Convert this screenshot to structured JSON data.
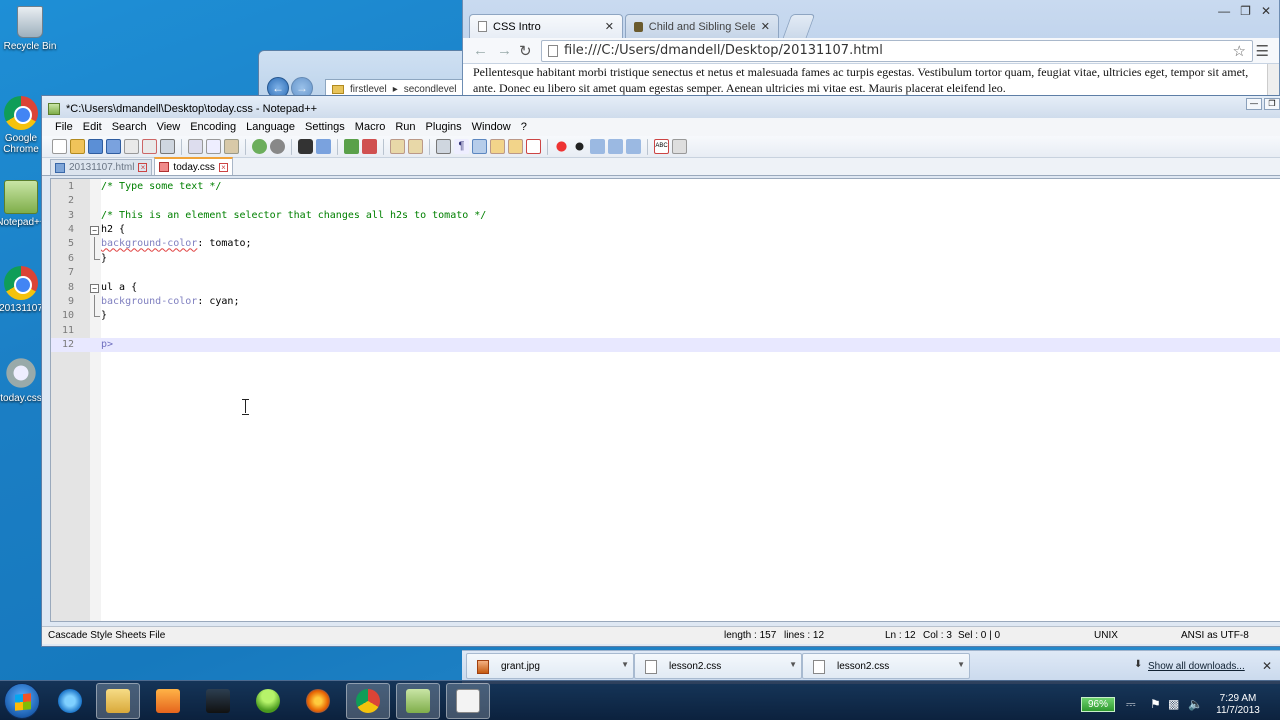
{
  "desktop": {
    "icons": [
      {
        "label": "Recycle Bin",
        "icon": "recycle-bin-icon"
      },
      {
        "label": "Google Chrome",
        "icon": "chrome-icon"
      },
      {
        "label": "Notepad++",
        "icon": "notepad-plus-plus-icon"
      },
      {
        "label": "20131107",
        "icon": "chrome-icon"
      },
      {
        "label": "today.css",
        "icon": "gear-icon"
      }
    ]
  },
  "explorer": {
    "crumbs": [
      "firstlevel",
      "secondlevel"
    ]
  },
  "browser": {
    "tabs": [
      {
        "label": "CSS Intro",
        "active": true
      },
      {
        "label": "Child and Sibling Selector",
        "active": false
      }
    ],
    "url": "file:///C:/Users/dmandell/Desktop/20131107.html",
    "content": "Pellentesque habitant morbi tristique senectus et netus et malesuada fames ac turpis egestas. Vestibulum tortor quam, feugiat vitae, ultricies eget, tempor sit amet, ante. Donec eu libero sit amet quam egestas semper. Aenean ultricies mi vitae est. Mauris placerat eleifend leo."
  },
  "notepad": {
    "title": "*C:\\Users\\dmandell\\Desktop\\today.css - Notepad++",
    "menu": [
      "File",
      "Edit",
      "Search",
      "View",
      "Encoding",
      "Language",
      "Settings",
      "Macro",
      "Run",
      "Plugins",
      "Window",
      "?"
    ],
    "doc_tabs": [
      {
        "label": "20131107.html",
        "active": false
      },
      {
        "label": "today.css",
        "active": true
      }
    ],
    "lines": [
      {
        "n": "1",
        "text": "/* Type some text */"
      },
      {
        "n": "2",
        "text": ""
      },
      {
        "n": "3",
        "text": "/* This is an element selector that changes all h2s to tomato */"
      },
      {
        "n": "4",
        "sel": "h2 {"
      },
      {
        "n": "5",
        "prop": "background-color",
        "val": ": tomato;"
      },
      {
        "n": "6",
        "text": "}"
      },
      {
        "n": "7",
        "text": ""
      },
      {
        "n": "8",
        "sel": "ul a {"
      },
      {
        "n": "9",
        "prop": "background-color",
        "val": ": cyan;"
      },
      {
        "n": "10",
        "text": "}"
      },
      {
        "n": "11",
        "text": ""
      },
      {
        "n": "12",
        "sel": "p>"
      }
    ],
    "status": {
      "file_type": "Cascade Style Sheets File",
      "length": "length : 157",
      "lines": "lines : 12",
      "ln": "Ln : 12",
      "col": "Col : 3",
      "sel": "Sel : 0 | 0",
      "eol": "UNIX",
      "encoding": "ANSI as UTF-8"
    }
  },
  "downloads": {
    "items": [
      "grant.jpg",
      "lesson2.css",
      "lesson2.css"
    ],
    "show_all": "Show all downloads..."
  },
  "taskbar": {
    "battery": "96%",
    "time": "7:29 AM",
    "date": "11/7/2013"
  }
}
